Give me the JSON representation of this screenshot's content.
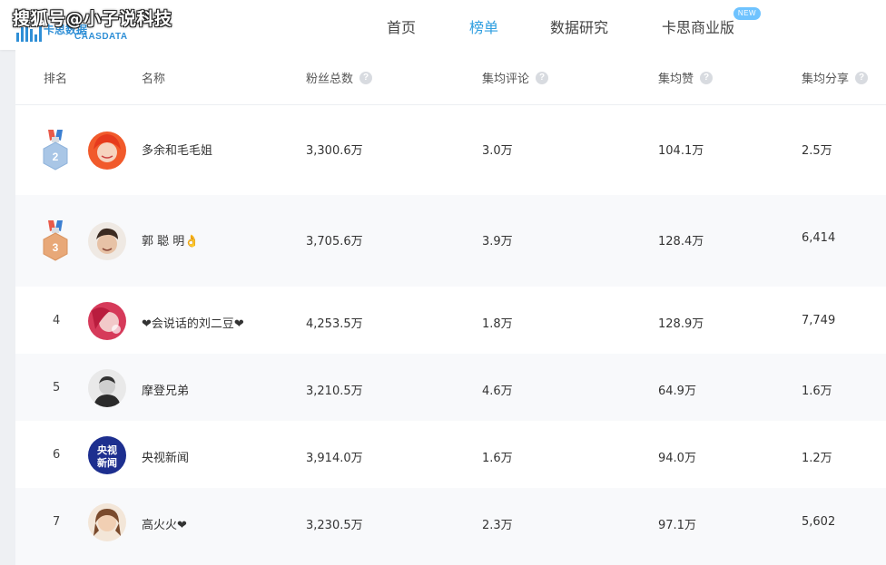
{
  "watermark": "搜狐号@小子说科技",
  "logo": {
    "cn": "卡思数据",
    "en": "CAASDATA"
  },
  "nav": {
    "home": "首页",
    "ranking": "榜单",
    "research": "数据研究",
    "business": "卡思商业版",
    "new_badge": "NEW"
  },
  "table": {
    "headers": {
      "rank": "排名",
      "name": "名称",
      "fans": "粉丝总数",
      "comments": "集均评论",
      "likes": "集均赞",
      "shares": "集均分享"
    },
    "help_icon": "?",
    "rows": [
      {
        "rank": "2",
        "name": "多余和毛毛姐",
        "fans": "3,300.6万",
        "comments": "3.0万",
        "likes": "104.1万",
        "shares": "2.5万"
      },
      {
        "rank": "3",
        "name": "郭 聪 明👌",
        "fans": "3,705.6万",
        "comments": "3.9万",
        "likes": "128.4万",
        "shares": "6,414"
      },
      {
        "rank": "4",
        "name": "❤会说话的刘二豆❤",
        "fans": "4,253.5万",
        "comments": "1.8万",
        "likes": "128.9万",
        "shares": "7,749"
      },
      {
        "rank": "5",
        "name": "摩登兄弟",
        "fans": "3,210.5万",
        "comments": "4.6万",
        "likes": "64.9万",
        "shares": "1.6万"
      },
      {
        "rank": "6",
        "name": "央视新闻",
        "fans": "3,914.0万",
        "comments": "1.6万",
        "likes": "94.0万",
        "shares": "1.2万"
      },
      {
        "rank": "7",
        "name": "高火火❤",
        "fans": "3,230.5万",
        "comments": "2.3万",
        "likes": "97.1万",
        "shares": "5,602"
      }
    ],
    "cctv_avatar": {
      "line1": "央视",
      "line2": "新闻"
    }
  },
  "colors": {
    "accent": "#2f9fe0",
    "silver_medal": "#a9c6e6",
    "bronze_medal": "#e8a878",
    "cctv_blue": "#1d2f8f"
  }
}
